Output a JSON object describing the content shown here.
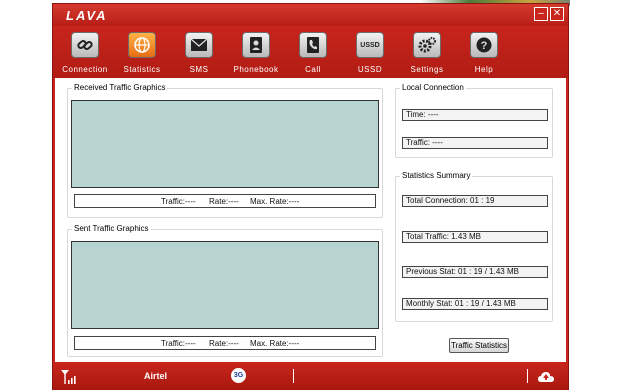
{
  "app": {
    "logo_text": "LAVA",
    "minimize_glyph": "–",
    "close_glyph": "✕"
  },
  "toolbar": {
    "items": [
      {
        "label": "Connection",
        "icon": "link-icon"
      },
      {
        "label": "Statistics",
        "icon": "globe-icon",
        "active": true
      },
      {
        "label": "SMS",
        "icon": "envelope-icon"
      },
      {
        "label": "Phonebook",
        "icon": "contact-card-icon"
      },
      {
        "label": "Call",
        "icon": "phone-icon"
      },
      {
        "label": "USSD",
        "icon": "ussd-icon",
        "icon_text": "USSD"
      },
      {
        "label": "Settings",
        "icon": "gear-icon"
      },
      {
        "label": "Help",
        "icon": "question-icon"
      }
    ]
  },
  "received": {
    "title": "Received Traffic Graphics",
    "traffic": "Traffic:----",
    "rate": "Rate:----",
    "max_rate": "Max. Rate:----"
  },
  "sent": {
    "title": "Sent Traffic Graphics",
    "traffic": "Traffic:----",
    "rate": "Rate:----",
    "max_rate": "Max. Rate:----"
  },
  "local_connection": {
    "title": "Local Connection",
    "time": "Time: ----",
    "traffic": "Traffic: ----"
  },
  "statistics_summary": {
    "title": "Statistics Summary",
    "total_connection": "Total Connection: 01 : 19",
    "total_traffic": "Total Traffic:     1.43 MB",
    "previous_stat": "Previous Stat:   01 : 19 /     1.43 MB",
    "monthly_stat": "Monthly Stat:   01 : 19 /     1.43 MB",
    "button_label": "Traffic Statistics"
  },
  "statusbar": {
    "operator": "Airtel",
    "network_badge": "3G",
    "colors": {
      "brand_red": "#c8251c",
      "graph_fill": "#b7d4d1"
    }
  }
}
